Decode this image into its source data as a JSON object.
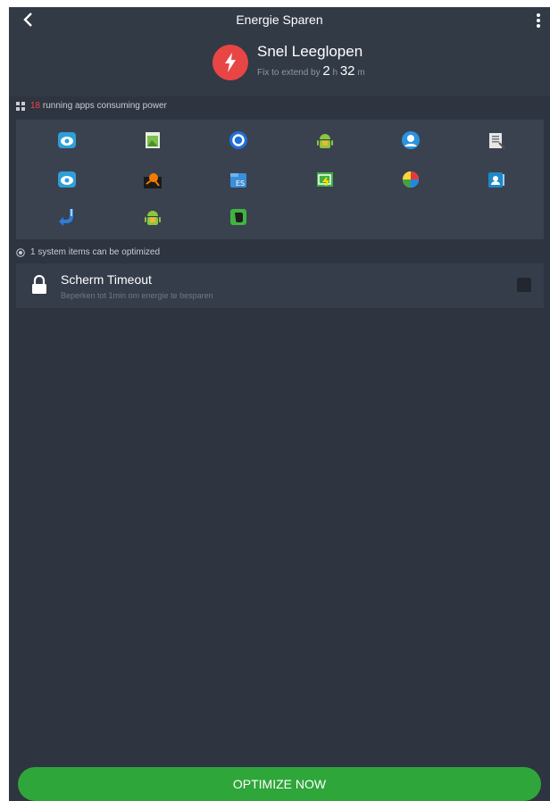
{
  "header": {
    "title": "Energie Sparen",
    "status_title": "Snel Leeglopen",
    "status_prefix": "Fix to extend by",
    "hours": "2",
    "hours_unit": "h",
    "minutes": "32",
    "minutes_unit": "m"
  },
  "apps_section": {
    "count": "18",
    "label": "running apps consuming power",
    "apps": [
      {
        "icon": "cloud-sync-icon"
      },
      {
        "icon": "gallery-icon"
      },
      {
        "icon": "blue-circle-app-icon"
      },
      {
        "icon": "android-robot-icon"
      },
      {
        "icon": "contact-avatar-icon"
      },
      {
        "icon": "document-list-icon"
      },
      {
        "icon": "cloud-sync-icon"
      },
      {
        "icon": "avast-icon"
      },
      {
        "icon": "es-file-explorer-icon"
      },
      {
        "icon": "green-battery-app-icon"
      },
      {
        "icon": "colorful-app-icon"
      },
      {
        "icon": "contacts-card-icon"
      },
      {
        "icon": "blue-arrow-app-icon"
      },
      {
        "icon": "android-robot-icon"
      },
      {
        "icon": "evernote-icon"
      }
    ]
  },
  "system_section": {
    "label": "1 system items can be optimized",
    "items": [
      {
        "title": "Scherm Timeout",
        "description": "Beperken tot 1min om energie te besparen",
        "checked": false
      }
    ]
  },
  "footer": {
    "button_label": "OPTIMIZE NOW"
  },
  "colors": {
    "background": "#2e3440",
    "accent_red": "#e84545",
    "button_green": "#2ea63a"
  }
}
